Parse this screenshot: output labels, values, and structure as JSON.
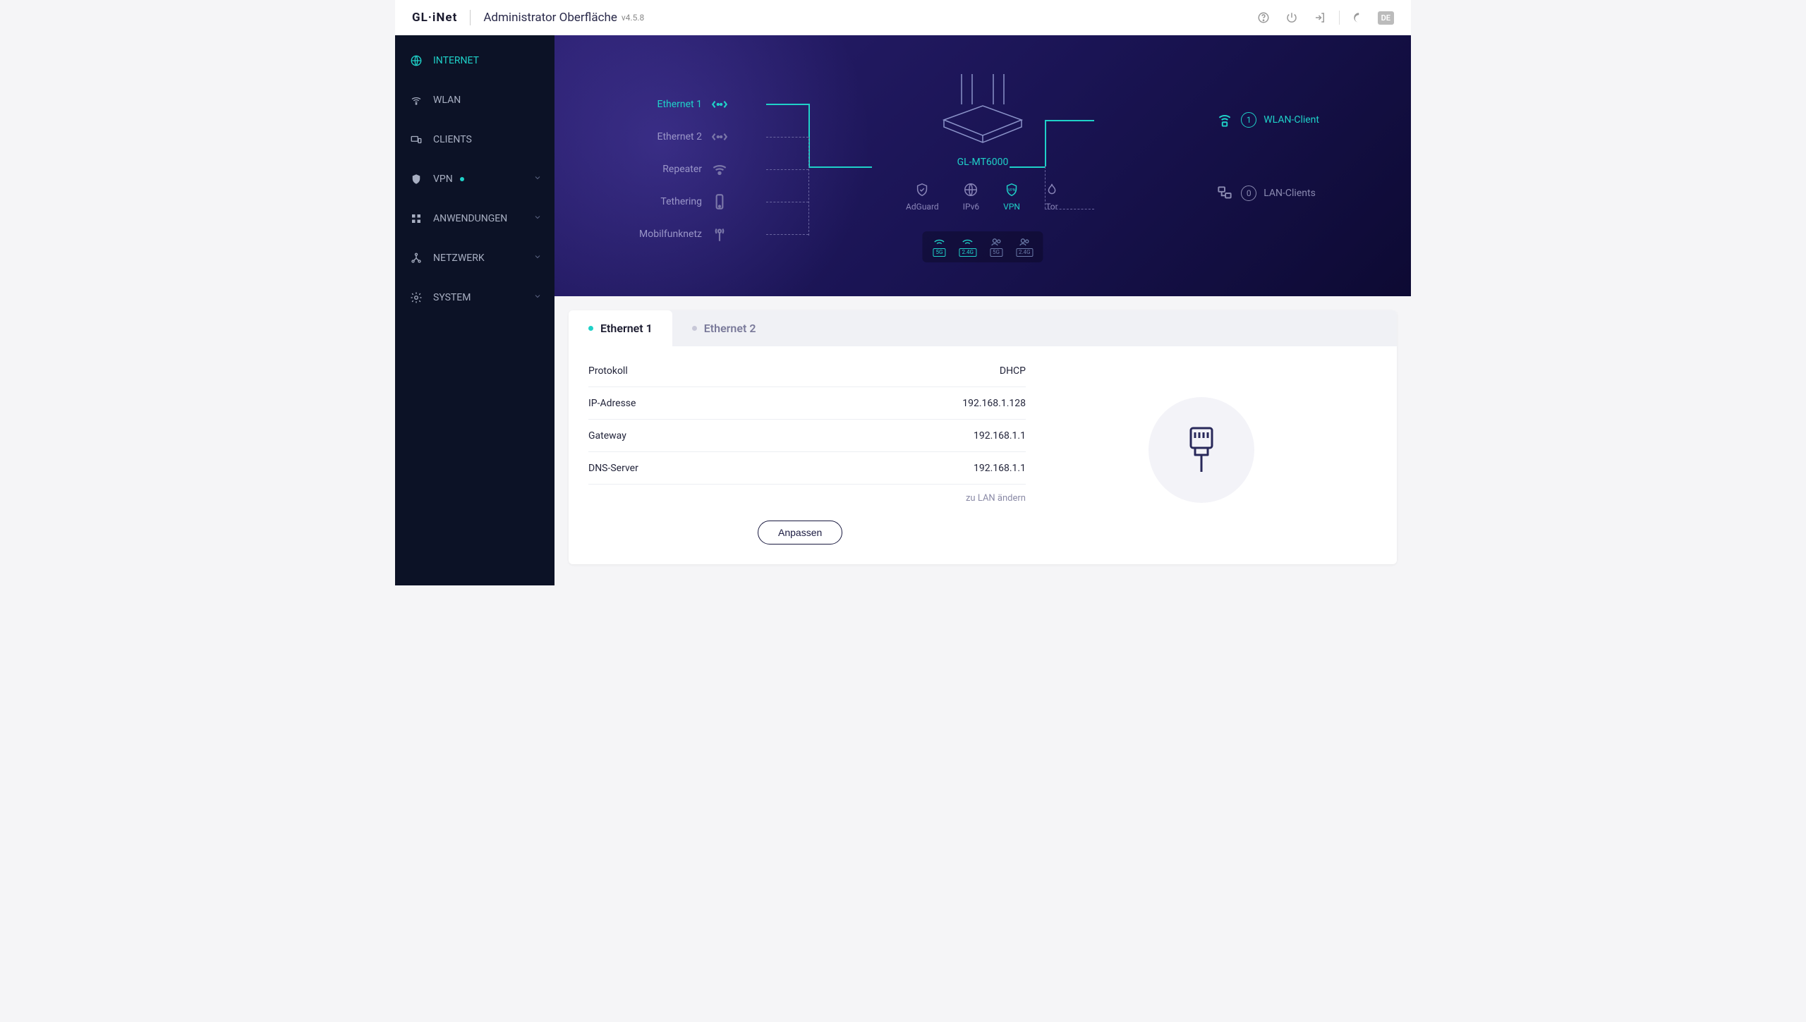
{
  "header": {
    "brand": "GL·iNet",
    "title": "Administrator Oberfläche",
    "version": "v4.5.8",
    "language": "DE"
  },
  "sidebar": {
    "items": [
      {
        "label": "INTERNET",
        "icon": "globe-icon",
        "active": true
      },
      {
        "label": "WLAN",
        "icon": "wifi-icon",
        "expandable": false
      },
      {
        "label": "CLIENTS",
        "icon": "devices-icon",
        "expandable": false
      },
      {
        "label": "VPN",
        "icon": "shield-icon",
        "status": true,
        "expandable": true
      },
      {
        "label": "ANWENDUNGEN",
        "icon": "apps-icon",
        "expandable": true
      },
      {
        "label": "NETZWERK",
        "icon": "network-icon",
        "expandable": true
      },
      {
        "label": "SYSTEM",
        "icon": "gear-icon",
        "expandable": true
      }
    ]
  },
  "diagram": {
    "model": "GL-MT6000",
    "left_connections": [
      {
        "label": "Ethernet 1",
        "state": "active"
      },
      {
        "label": "Ethernet 2",
        "state": "inactive"
      },
      {
        "label": "Repeater",
        "state": "inactive"
      },
      {
        "label": "Tethering",
        "state": "inactive"
      },
      {
        "label": "Mobilfunknetz",
        "state": "inactive"
      }
    ],
    "features": [
      {
        "label": "AdGuard",
        "on": false
      },
      {
        "label": "IPv6",
        "on": false
      },
      {
        "label": "VPN",
        "on": true
      },
      {
        "label": "Tor",
        "on": false
      }
    ],
    "radios": [
      {
        "band": "5G",
        "type": "ap",
        "on": true
      },
      {
        "band": "2.4G",
        "type": "ap",
        "on": true
      },
      {
        "band": "5G",
        "type": "guest",
        "on": false
      },
      {
        "band": "2.4G",
        "type": "guest",
        "on": false
      }
    ],
    "right_clients": [
      {
        "count": 1,
        "label": "WLAN-Client",
        "on": true
      },
      {
        "count": 0,
        "label": "LAN-Clients",
        "on": false
      }
    ]
  },
  "details": {
    "tabs": [
      {
        "label": "Ethernet 1",
        "active": true
      },
      {
        "label": "Ethernet 2",
        "active": false
      }
    ],
    "rows": [
      {
        "key": "Protokoll",
        "value": "DHCP"
      },
      {
        "key": "IP-Adresse",
        "value": "192.168.1.128"
      },
      {
        "key": "Gateway",
        "value": "192.168.1.1"
      },
      {
        "key": "DNS-Server",
        "value": "192.168.1.1"
      }
    ],
    "change_to_lan": "zu LAN ändern",
    "adjust_button": "Anpassen"
  }
}
